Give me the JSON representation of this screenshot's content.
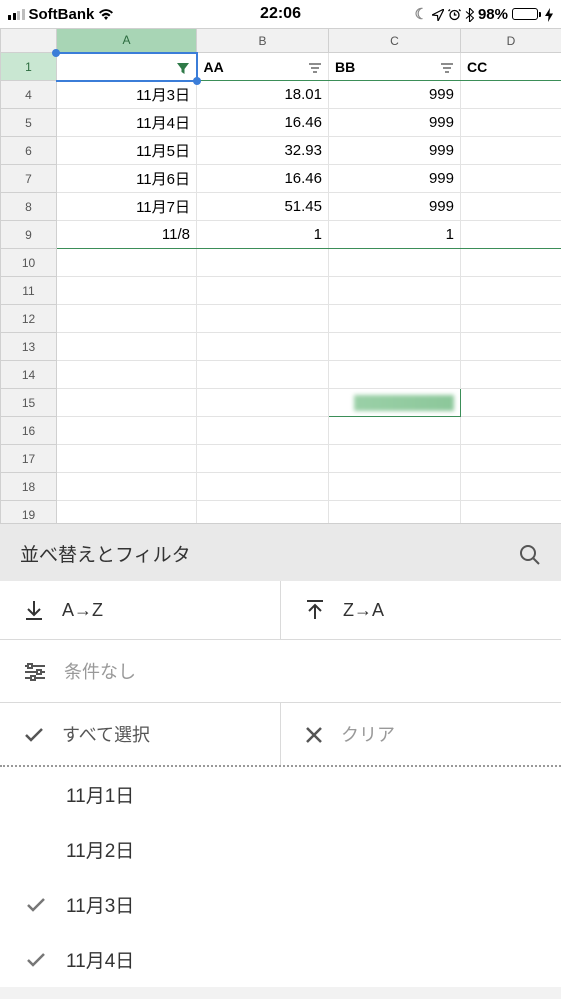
{
  "status_bar": {
    "carrier": "SoftBank",
    "time": "22:06",
    "battery_pct": "98%"
  },
  "sheet": {
    "col_headers": [
      "A",
      "B",
      "C",
      "D"
    ],
    "row_headers": [
      "1",
      "4",
      "5",
      "6",
      "7",
      "8",
      "9",
      "10",
      "11",
      "12",
      "13",
      "14",
      "15",
      "16",
      "17",
      "18",
      "19"
    ],
    "header_row": {
      "a": "",
      "b": "AA",
      "c": "BB",
      "d": "CC"
    },
    "rows": [
      {
        "a": "11月3日",
        "b": "18.01",
        "c": "999",
        "d": ""
      },
      {
        "a": "11月4日",
        "b": "16.46",
        "c": "999",
        "d": ""
      },
      {
        "a": "11月5日",
        "b": "32.93",
        "c": "999",
        "d": ""
      },
      {
        "a": "11月6日",
        "b": "16.46",
        "c": "999",
        "d": ""
      },
      {
        "a": "11月7日",
        "b": "51.45",
        "c": "999",
        "d": ""
      },
      {
        "a": "11/8",
        "b": "1",
        "c": "1",
        "d": ""
      }
    ]
  },
  "panel": {
    "title": "並べ替えとフィルタ",
    "sort_az": "A→Z",
    "sort_za": "Z→A",
    "condition_placeholder": "条件なし",
    "select_all": "すべて選択",
    "clear": "クリア",
    "values": [
      {
        "label": "11月1日",
        "checked": false
      },
      {
        "label": "11月2日",
        "checked": false
      },
      {
        "label": "11月3日",
        "checked": true
      },
      {
        "label": "11月4日",
        "checked": true
      }
    ]
  }
}
